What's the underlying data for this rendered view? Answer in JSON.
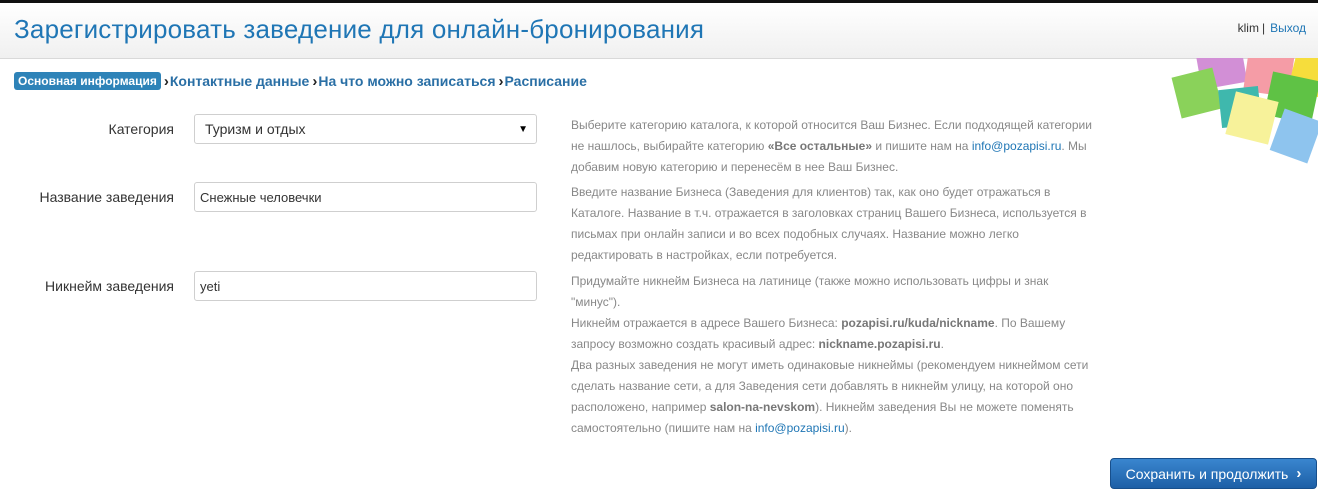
{
  "header": {
    "title": "Зарегистрировать заведение для онлайн-бронирования",
    "user_name": "klim",
    "separator": "|",
    "logout_label": "Выход"
  },
  "breadcrumb": {
    "steps": [
      {
        "label": "Основная информация",
        "active": true
      },
      {
        "label": "Контактные данные",
        "active": false
      },
      {
        "label": "На что можно записаться",
        "active": false
      },
      {
        "label": "Расписание",
        "active": false
      }
    ],
    "separator_icon": "chevron-right-icon"
  },
  "form": {
    "category": {
      "label": "Категория",
      "value": "Туризм и отдых",
      "help": {
        "part1": "Выберите категорию каталога, к которой относится Ваш Бизнес. Если подходящей категории не нашлось, выбирайте категорию ",
        "bold1": "«Все остальные»",
        "part2": " и пишите нам на ",
        "email": "info@pozapisi.ru",
        "part3": ". Мы добавим новую категорию и перенесём в нее Ваш Бизнес."
      }
    },
    "name": {
      "label": "Название заведения",
      "value": "Снежные человечки",
      "help": "Введите название Бизнеса (Заведения для клиентов) так, как оно будет отражаться в Каталоге. Название в т.ч. отражается в заголовках страниц Вашего Бизнеса, используется в письмах при онлайн записи и во всех подобных случаях. Название можно легко редактировать в настройках, если потребуется."
    },
    "nickname": {
      "label": "Никнейм заведения",
      "value": "yeti",
      "help": {
        "p1": "Придумайте никнейм Бизнеса на латинице (также можно использовать цифры и знак \"минус\").",
        "p2_a": "Никнейм отражается в адресе Вашего Бизнеса: ",
        "p2_bold1": "pozapisi.ru/kuda/nickname",
        "p2_b": ". По Вашему запросу возможно создать красивый адрес: ",
        "p2_bold2": "nickname.pozapisi.ru",
        "p2_c": ".",
        "p3_a": "Два разных заведения не могут иметь одинаковые никнеймы (рекомендуем никнеймом сети сделать название сети, а для Заведения сети добавлять в никнейм улицу, на которой оно расположено, например ",
        "p3_bold": "salon-na-nevskom",
        "p3_b": "). Никнейм заведения Вы не можете поменять самостоятельно (пишите нам на ",
        "p3_email": "info@pozapisi.ru",
        "p3_c": ")."
      }
    }
  },
  "actions": {
    "save_label": "Сохранить и продолжить",
    "save_icon": "chevron-right-icon"
  },
  "colors": {
    "accent": "#1f76b5",
    "active_step_bg": "#2e83b8",
    "help_text": "#888888",
    "button_top": "#3a86cf",
    "button_bottom": "#1d5fa6"
  }
}
